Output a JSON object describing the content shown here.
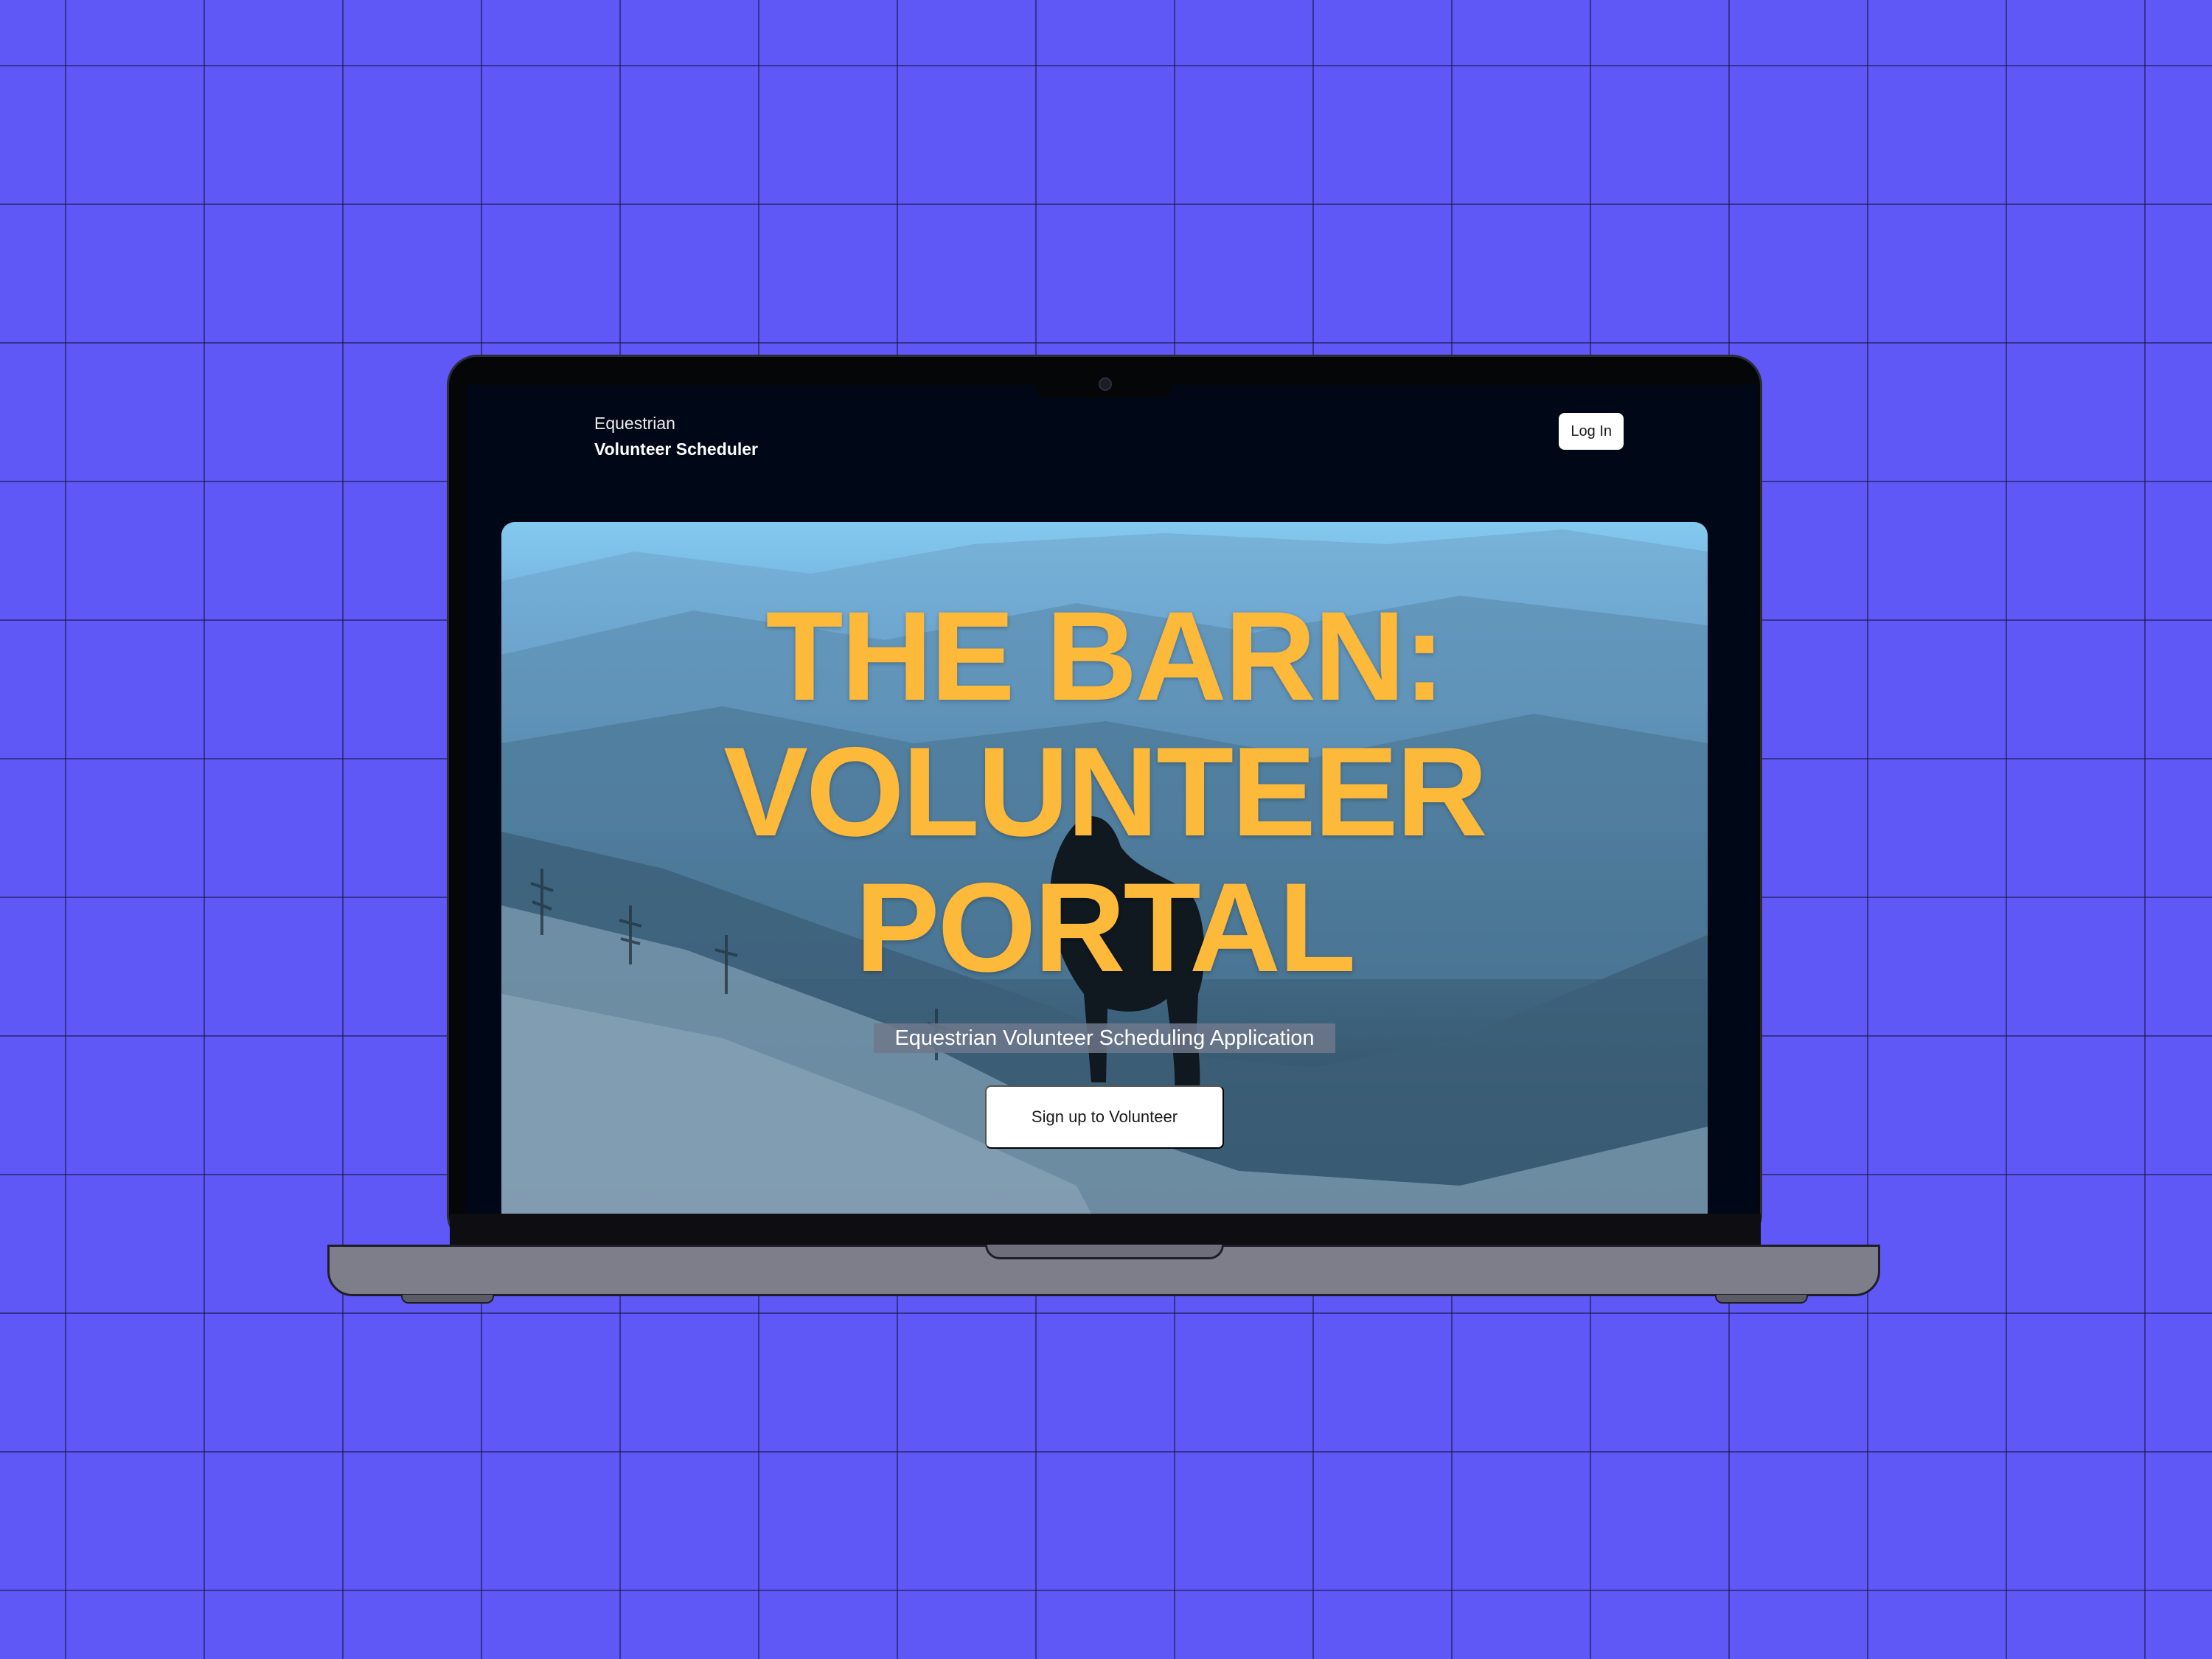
{
  "app": {
    "brand_line1": "Equestrian",
    "brand_line2": "Volunteer Scheduler"
  },
  "header": {
    "login_label": "Log In"
  },
  "hero": {
    "title_lines": [
      "THE BARN:",
      "VOLUNTEER",
      "PORTAL"
    ],
    "subtitle": "Equestrian Volunteer Scheduling Application",
    "cta_label": "Sign up to Volunteer"
  },
  "colors": {
    "background": "#5f57f6",
    "title_accent": "#fcb93a",
    "screen_bg": "#000716"
  },
  "icons": {
    "camera": "webcam-icon"
  }
}
